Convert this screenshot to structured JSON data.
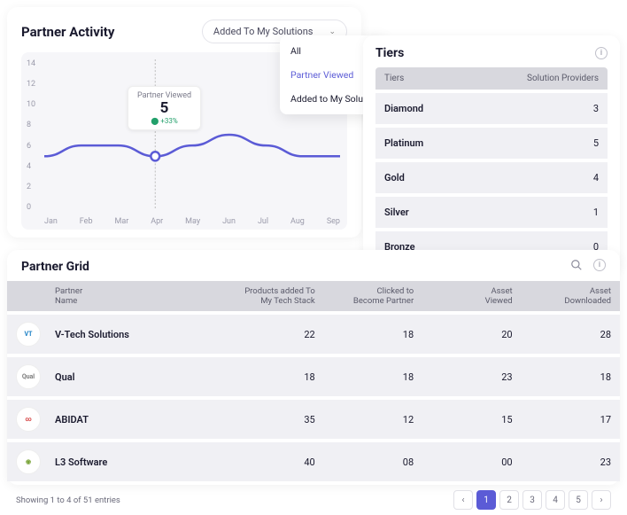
{
  "chart": {
    "title": "Partner Activity",
    "filter_label": "Added To My Solutions",
    "tooltip": {
      "label": "Partner Viewed",
      "value": "5",
      "delta": "+33%"
    }
  },
  "dropdown": {
    "items": [
      "All",
      "Partner Viewed",
      "Added to My Solutions"
    ],
    "selected_index": 1
  },
  "chart_data": {
    "type": "line",
    "categories": [
      "Jan",
      "Feb",
      "Mar",
      "Apr",
      "May",
      "Jun",
      "Jul",
      "Aug",
      "Sep"
    ],
    "values": [
      5,
      6,
      6,
      5,
      6,
      7,
      6,
      5,
      5
    ],
    "title": "Partner Activity",
    "xlabel": "",
    "ylabel": "",
    "ylim": [
      0,
      14
    ],
    "yticks": [
      0,
      2,
      4,
      6,
      8,
      10,
      12,
      14
    ],
    "highlight": {
      "x": "Apr",
      "y": 5
    }
  },
  "tiers": {
    "title": "Tiers",
    "col1": "Tiers",
    "col2": "Solution Providers",
    "rows": [
      {
        "name": "Diamond",
        "count": "3"
      },
      {
        "name": "Platinum",
        "count": "5"
      },
      {
        "name": "Gold",
        "count": "4"
      },
      {
        "name": "Silver",
        "count": "1"
      },
      {
        "name": "Bronze",
        "count": "0"
      }
    ]
  },
  "grid": {
    "title": "Partner Grid",
    "headers": {
      "name_l1": "Partner",
      "name_l2": "Name",
      "c1_l1": "Products added To",
      "c1_l2": "My Tech Stack",
      "c2_l1": "Clicked to",
      "c2_l2": "Become Partner",
      "c3_l1": "Asset",
      "c3_l2": "Viewed",
      "c4_l1": "Asset",
      "c4_l2": "Downloaded"
    },
    "rows": [
      {
        "logo": "VT",
        "logo_color": "#1a7fc4",
        "name": "V-Tech Solutions",
        "c1": "22",
        "c2": "18",
        "c3": "20",
        "c4": "28"
      },
      {
        "logo": "Qual",
        "logo_color": "#7a7a7a",
        "name": "Qual",
        "c1": "18",
        "c2": "18",
        "c3": "23",
        "c4": "18"
      },
      {
        "logo": "∞",
        "logo_color": "#d64545",
        "name": "ABIDAT",
        "c1": "35",
        "c2": "12",
        "c3": "15",
        "c4": "17"
      },
      {
        "logo": "◉",
        "logo_color": "#7aa43a",
        "name": "L3 Software",
        "c1": "40",
        "c2": "08",
        "c3": "00",
        "c4": "23"
      }
    ],
    "pager": {
      "summary": "Showing 1 to 4 of 51 entries",
      "pages": [
        "1",
        "2",
        "3",
        "4",
        "5"
      ],
      "active": 0,
      "prev": "‹",
      "next": "›"
    }
  }
}
